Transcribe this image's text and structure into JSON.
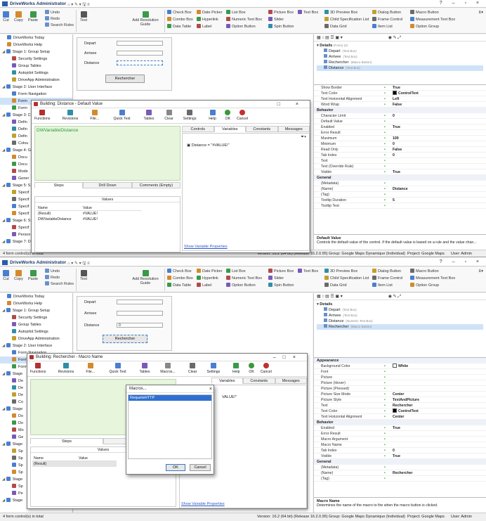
{
  "app": {
    "title": "DriveWorks Administrator",
    "window_controls": "? – ▫ ×"
  },
  "ribbon": {
    "clipboard": [
      "Cut",
      "Copy",
      "Paste",
      "Undo",
      "Redo",
      "Search Rules"
    ],
    "text_label": "Text",
    "add_resolution_guide": "Add Resolution Guide",
    "controls": [
      [
        "Check Box",
        "Combo Box",
        "Data Table"
      ],
      [
        "Date Picker",
        "Hyperlink",
        "Label"
      ],
      [
        "List Box",
        "Numeric Text Box",
        "Option Button"
      ],
      [
        "Picture Box",
        "Slider",
        "Spin Button"
      ],
      [
        "Text Box"
      ],
      [
        "3D Preview Box",
        "Child Specification List",
        "Data Grid"
      ],
      [
        "Dialog Button",
        "Frame Control",
        "Item List"
      ],
      [
        "Macro Button",
        "Measurement Text Box",
        "Option Group"
      ]
    ]
  },
  "top": {
    "nav": [
      {
        "label": "DriveWorks Today",
        "indent": 1
      },
      {
        "label": "DriveWorks Help",
        "indent": 1
      },
      {
        "label": "Stage 1: Group Setup",
        "indent": 0
      },
      {
        "label": "Security Settings",
        "indent": 2
      },
      {
        "label": "Group Tables",
        "indent": 2
      },
      {
        "label": "Autopilot Settings",
        "indent": 2
      },
      {
        "label": "DriveApp Administration",
        "indent": 2
      },
      {
        "label": "Stage 2: User Interface",
        "indent": 0
      },
      {
        "label": "Form Navigation",
        "indent": 2
      },
      {
        "label": "Form",
        "indent": 2,
        "selected": true
      },
      {
        "label": "Form",
        "indent": 2
      },
      {
        "label": "Stage 3: C",
        "indent": 0
      },
      {
        "label": "Defin",
        "indent": 2
      },
      {
        "label": "Defin",
        "indent": 2
      },
      {
        "label": "Defin",
        "indent": 2
      },
      {
        "label": "Colou",
        "indent": 2
      },
      {
        "label": "Stage 4: G",
        "indent": 0
      },
      {
        "label": "Docu",
        "indent": 2
      },
      {
        "label": "Docu",
        "indent": 2
      },
      {
        "label": "Mode",
        "indent": 2
      },
      {
        "label": "Gener",
        "indent": 2
      },
      {
        "label": "Stage 5: S",
        "indent": 0
      },
      {
        "label": "Specif",
        "indent": 2
      },
      {
        "label": "Specif",
        "indent": 2
      },
      {
        "label": "Specif",
        "indent": 2
      },
      {
        "label": "Specif",
        "indent": 2
      },
      {
        "label": "Stage 6: S",
        "indent": 0
      },
      {
        "label": "Specif",
        "indent": 2
      },
      {
        "label": "Person",
        "indent": 2
      },
      {
        "label": "Stage 7: D",
        "indent": 0
      }
    ],
    "form": {
      "depart": "Depart",
      "arrivee": "Arrivee",
      "distance": "Distance",
      "button": "Rechercher"
    },
    "tree_header": "Details",
    "tree_header_meta": "(Form) (4)",
    "tree": [
      {
        "name": "Depart",
        "meta": "(Text Box)"
      },
      {
        "name": "Arrivee",
        "meta": "(Text Box)"
      },
      {
        "name": "Rechercher",
        "meta": "(Macro Button)"
      },
      {
        "name": "Distance",
        "meta": "(Text Box)",
        "selected": true
      }
    ],
    "grid": [
      {
        "k": "Show Border",
        "v": "True"
      },
      {
        "k": "Text Color",
        "v": "ControlText",
        "sw": "#000000"
      },
      {
        "k": "Text Horizontal Alignment",
        "v": "Left"
      },
      {
        "k": "Word Wrap",
        "v": "False"
      },
      {
        "section": "Behavior"
      },
      {
        "k": "Character Limit",
        "v": "0"
      },
      {
        "k": "Default Value",
        "v": ""
      },
      {
        "k": "Enabled",
        "v": "True"
      },
      {
        "k": "Error Result",
        "v": ""
      },
      {
        "k": "Maximum",
        "v": "100"
      },
      {
        "k": "Minimum",
        "v": "0"
      },
      {
        "k": "Read Only",
        "v": "False"
      },
      {
        "k": "Tab Index",
        "v": "0"
      },
      {
        "k": "Text",
        "v": ""
      },
      {
        "k": "Text (Override Rule)",
        "v": ""
      },
      {
        "k": "Visible",
        "v": "True"
      },
      {
        "section": "General"
      },
      {
        "k": "(Metadata)",
        "v": ""
      },
      {
        "k": "(Name)",
        "v": "Distance"
      },
      {
        "k": "(Tag)",
        "v": ""
      },
      {
        "k": "Tooltip Duration",
        "v": "5"
      },
      {
        "k": "Tooltip Text",
        "v": ""
      }
    ],
    "desc_title": "Default Value",
    "desc_text": "Controls the default value of the control. If the default value is based on a rule and the value chan...",
    "status": {
      "left": "4 form control(s) in total",
      "version": "Version: 16.2 (64 bit) (Release 16.2.0.95)",
      "group": "Group: Google Maps Dynamique (Individual)",
      "project": "Project: Google Maps",
      "user": "User: Admin"
    },
    "dialog": {
      "title": "Building: Distance - Default Value",
      "toolbar": [
        "Functions",
        "Revisions",
        "File...",
        "Quick Text",
        "Tables",
        "Clear",
        "Settings",
        "Help",
        "OK",
        "Cancel"
      ],
      "rule": "DWVariableDistance",
      "tabs": [
        "Steps",
        "Drill Down",
        "Comments (Empty)"
      ],
      "values_label": "Values",
      "table_head": [
        "Name",
        "Value"
      ],
      "table_rows": [
        [
          "(Result)",
          "#VALUE!"
        ],
        [
          "DWVariableDistance",
          "#VALUE!"
        ]
      ],
      "right_tabs": [
        "Controls",
        "Variables",
        "Constants",
        "Messages"
      ],
      "variable": "Distance = \"#VALUE!\"",
      "link": "Show Variable Properties"
    }
  },
  "bottom": {
    "nav": [
      {
        "label": "DriveWorks Today",
        "indent": 1
      },
      {
        "label": "DriveWorks Help",
        "indent": 1
      },
      {
        "label": "Stage 1: Group Setup",
        "indent": 0
      },
      {
        "label": "Security Settings",
        "indent": 2
      },
      {
        "label": "Group Tables",
        "indent": 2
      },
      {
        "label": "Autopilot Settings",
        "indent": 2
      },
      {
        "label": "DriveApp Administration",
        "indent": 2
      },
      {
        "label": "Stage 2: User Interface",
        "indent": 0
      },
      {
        "label": "Form Navigation",
        "indent": 2
      },
      {
        "label": "Form",
        "indent": 2,
        "selected": true
      },
      {
        "label": "Form",
        "indent": 2
      },
      {
        "label": "Stage",
        "indent": 0
      },
      {
        "label": "De",
        "indent": 2
      },
      {
        "label": "De",
        "indent": 2
      },
      {
        "label": "De",
        "indent": 2
      },
      {
        "label": "Co",
        "indent": 2
      },
      {
        "label": "Stage",
        "indent": 0
      },
      {
        "label": "Do",
        "indent": 2
      },
      {
        "label": "Do",
        "indent": 2
      },
      {
        "label": "Mo",
        "indent": 2
      },
      {
        "label": "Ge",
        "indent": 2
      },
      {
        "label": "Stage",
        "indent": 0
      },
      {
        "label": "Sp",
        "indent": 2
      },
      {
        "label": "Sp",
        "indent": 2
      },
      {
        "label": "Sp",
        "indent": 2
      },
      {
        "label": "Sp",
        "indent": 2
      },
      {
        "label": "Stage",
        "indent": 0
      },
      {
        "label": "Sp",
        "indent": 2
      },
      {
        "label": "Pe",
        "indent": 2
      },
      {
        "label": "Stage",
        "indent": 0
      }
    ],
    "form": {
      "depart": "Depart",
      "arrivee": "Arrivee",
      "distance": "Distance",
      "distance_value": "0",
      "button": "Rechercher"
    },
    "tree_header": "Details",
    "tree": [
      {
        "name": "Depart",
        "meta": "(Text Box)"
      },
      {
        "name": "Arrivee",
        "meta": "(Text Box)"
      },
      {
        "name": "Distance",
        "meta": "(Numeric Text Box)"
      },
      {
        "name": "Rechercher",
        "meta": "(Macro Button)",
        "selected": true
      }
    ],
    "grid": [
      {
        "section": "Appearance"
      },
      {
        "k": "Background Color",
        "v": "White",
        "sw": "#ffffff"
      },
      {
        "k": "Font",
        "v": ""
      },
      {
        "k": "Picture",
        "v": ""
      },
      {
        "k": "Picture (Hover)",
        "v": ""
      },
      {
        "k": "Picture (Pressed)",
        "v": ""
      },
      {
        "k": "Picture Size Mode",
        "v": "Center"
      },
      {
        "k": "Picture Style",
        "v": "TextAndPicture"
      },
      {
        "k": "Text",
        "v": "Rechercher"
      },
      {
        "k": "Text Color",
        "v": "ControlText",
        "sw": "#000000"
      },
      {
        "k": "Text Horizontal Alignment",
        "v": "Center"
      },
      {
        "section": "Behavior"
      },
      {
        "k": "Enabled",
        "v": "True"
      },
      {
        "k": "Error Result",
        "v": ""
      },
      {
        "k": "Macro Argument",
        "v": ""
      },
      {
        "k": "Macro Name",
        "v": ""
      },
      {
        "k": "Tab Index",
        "v": "0"
      },
      {
        "k": "Visible",
        "v": "True"
      },
      {
        "section": "General"
      },
      {
        "k": "(Metadata)",
        "v": ""
      },
      {
        "k": "(Name)",
        "v": "Rechercher"
      },
      {
        "k": "(Tag)",
        "v": ""
      }
    ],
    "desc_title": "Macro Name",
    "desc_text": "Determines the name of the macro to fire when the macro button is clicked.",
    "status": {
      "left": "4 form control(s) in total",
      "version": "Version: 16.2 (64 bit) (Release 16.2.0.95)",
      "group": "Group: Google Maps Dynamique (Individual)",
      "project": "Project: Google Maps",
      "user": "User: Admin"
    },
    "dialog": {
      "title": "Building: Rechercher - Macro Name",
      "toolbar": [
        "Functions",
        "Revisions",
        "File...",
        "Quick Text",
        "Tables",
        "Macros...",
        "Clear",
        "Settings",
        "Help",
        "OK",
        "Cancel"
      ],
      "tabs": [
        "Steps",
        "Drill Down"
      ],
      "values_label": "Values",
      "table_head": [
        "Name",
        "Value"
      ],
      "table_rows": [
        [
          "(Result)",
          ""
        ]
      ],
      "right_tabs": [
        "Variables",
        "Constants",
        "Messages"
      ],
      "variable_partial": "VALUE!\"",
      "link": "Show Variable Properties"
    },
    "macros": {
      "title": "Macros...",
      "item": "RequeteHTTP",
      "ok": "OK",
      "cancel": "Cancel"
    }
  }
}
